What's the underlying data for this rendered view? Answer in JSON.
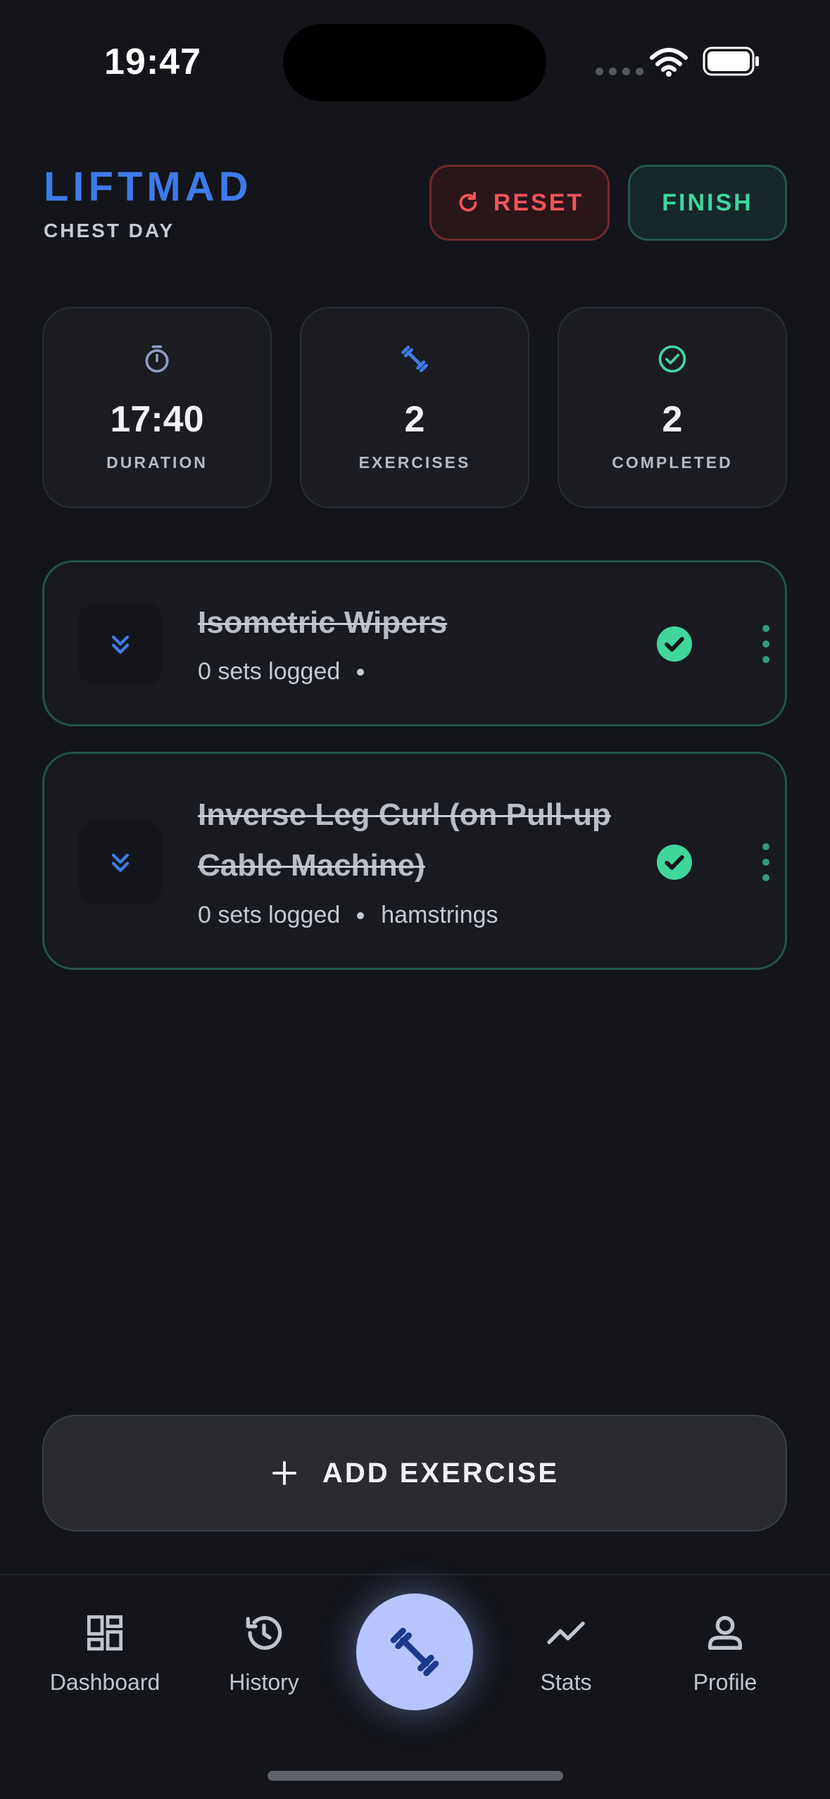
{
  "status_bar": {
    "time": "19:47"
  },
  "header": {
    "brand": "LIFTMAD",
    "subtitle": "CHEST DAY",
    "reset_label": "RESET",
    "finish_label": "FINISH"
  },
  "stats": [
    {
      "icon": "stopwatch-icon",
      "value": "17:40",
      "label": "DURATION"
    },
    {
      "icon": "dumbbell-icon",
      "value": "2",
      "label": "EXERCISES"
    },
    {
      "icon": "check-circle-icon",
      "value": "2",
      "label": "COMPLETED"
    }
  ],
  "exercises": [
    {
      "name": "Isometric Wipers",
      "sets": "0 sets logged",
      "muscle": "",
      "completed": true
    },
    {
      "name": "Inverse Leg Curl (on Pull-up Cable Machine)",
      "sets": "0 sets logged",
      "muscle": "hamstrings",
      "completed": true
    }
  ],
  "add_exercise_label": "ADD EXERCISE",
  "nav": {
    "items": [
      {
        "label": "Dashboard",
        "icon": "dashboard-icon"
      },
      {
        "label": "History",
        "icon": "history-icon"
      },
      {
        "label": "Stats",
        "icon": "stats-icon"
      },
      {
        "label": "Profile",
        "icon": "profile-icon"
      }
    ],
    "center_icon": "dumbbell-icon"
  },
  "colors": {
    "accent": "#3d7bea",
    "danger": "#f0545a",
    "success": "#40d69c",
    "background": "#13151a"
  }
}
